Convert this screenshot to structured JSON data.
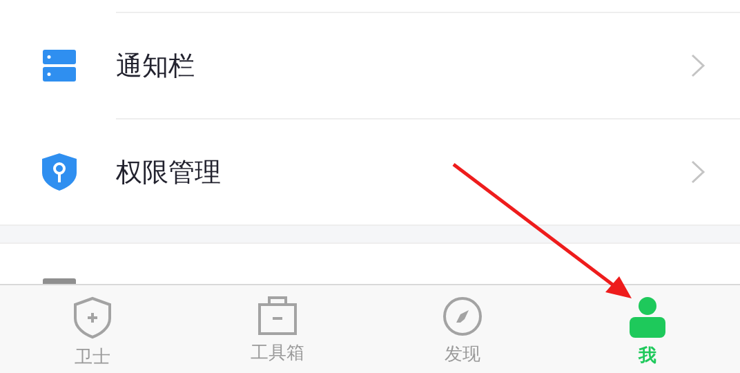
{
  "settings_list": [
    {
      "kind": "notification",
      "label": "通知栏"
    },
    {
      "kind": "permission",
      "label": "权限管理"
    }
  ],
  "partial_row": {
    "kind": "system"
  },
  "tab_bar": [
    {
      "kind": "guard",
      "label": "卫士",
      "selected": false
    },
    {
      "kind": "toolbox",
      "label": "工具箱",
      "selected": false
    },
    {
      "kind": "discover",
      "label": "发现",
      "selected": false
    },
    {
      "kind": "me",
      "label": "我",
      "selected": true
    }
  ]
}
